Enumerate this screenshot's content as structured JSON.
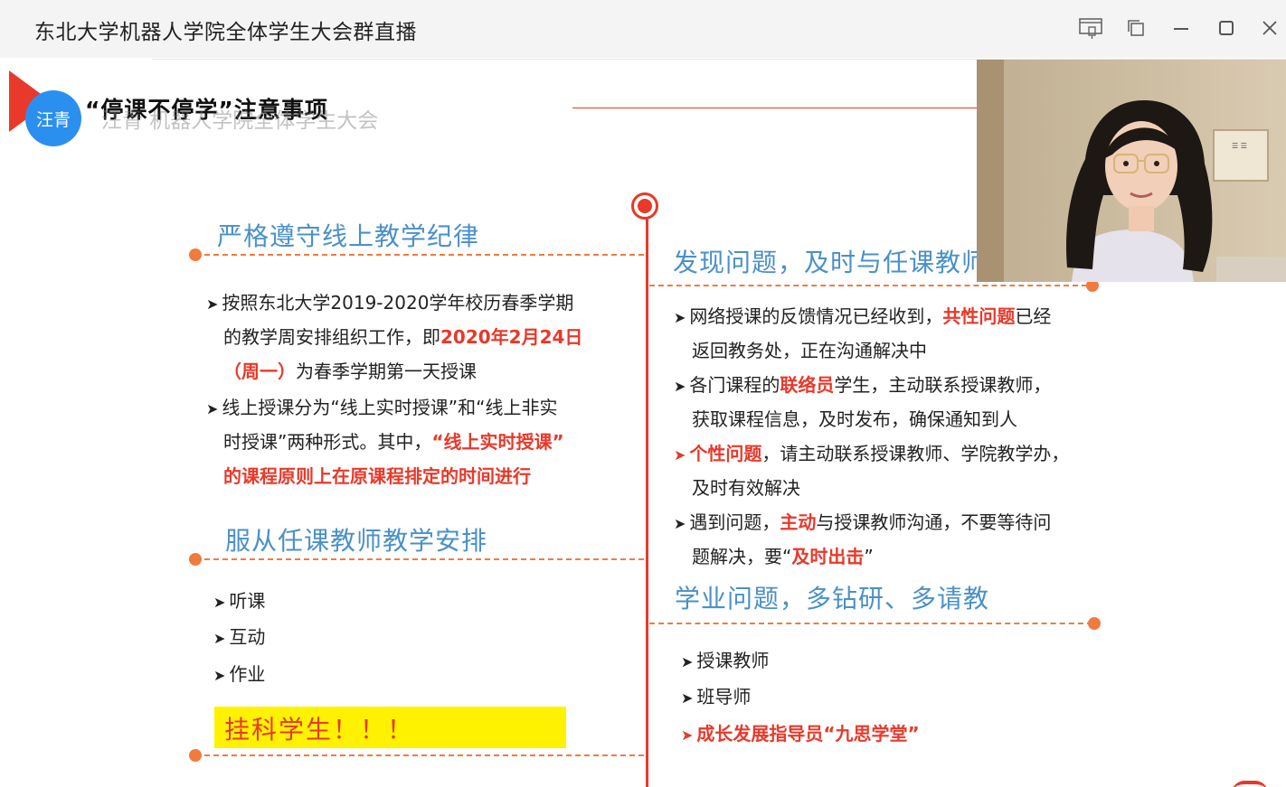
{
  "window": {
    "title": "东北大学机器人学院全体学生大会群直播",
    "controls": [
      "presentation-icon",
      "popout-icon",
      "minimize-icon",
      "maximize-icon",
      "close-icon"
    ]
  },
  "presenter": {
    "avatar_label": "汪青"
  },
  "slide": {
    "title": "“停课不停学”注意事项",
    "overlay_text": "汪青 机器人学院全体学生大会",
    "left": {
      "section1": {
        "title": "严格遵守线上教学纪律",
        "lines": [
          {
            "a": "按照东北大学2019-2020学年校历春季学期",
            "b": "",
            "c": ""
          },
          {
            "a": "的教学周安排组织工作，即",
            "b": "2020年2月24日",
            "c": ""
          },
          {
            "a": "",
            "b": "（周一）",
            "c": "为春季学期第一天授课"
          },
          {
            "a": "线上授课分为“线上实时授课”和“线上非实",
            "b": "",
            "c": ""
          },
          {
            "a": "时授课”两种形式。其中，",
            "b": "“线上实时授课”",
            "c": ""
          },
          {
            "a": "",
            "b": "的课程原则上在原课程排定的时间进行",
            "c": ""
          }
        ]
      },
      "section2": {
        "title": "服从任课教师教学安排",
        "items": [
          "听课",
          "互动",
          "作业"
        ],
        "highlight": "挂科学生！！！"
      }
    },
    "right": {
      "section1": {
        "title": "发现问题，及时与任课教师",
        "lines": [
          {
            "a": "网络授课的反馈情况已经收到，",
            "b": "共性问题",
            "c": "已经"
          },
          {
            "a": "返回教务处，正在沟通解决中",
            "b": "",
            "c": ""
          },
          {
            "a": "各门课程的",
            "b": "联络员",
            "c": "学生，主动联系授课教师，"
          },
          {
            "a": "获取课程信息，及时发布，确保通知到人",
            "b": "",
            "c": ""
          },
          {
            "a": "",
            "b": "个性问题",
            "c": "，请主动联系授课教师、学院教学办，"
          },
          {
            "a": "及时有效解决",
            "b": "",
            "c": ""
          },
          {
            "a": "遇到问题，",
            "b": "主动",
            "c": "与授课教师沟通，不要等待问"
          },
          {
            "a": "题解决，要“",
            "b": "及时出击",
            "c": "”"
          }
        ]
      },
      "section2": {
        "title": "学业问题，多钻研、多请教",
        "items": [
          "授课教师",
          "班导师"
        ],
        "highlight": "成长发展指导员“九思学堂”"
      }
    }
  },
  "colors": {
    "accent": "#e8392a",
    "orange": "#f07b3f",
    "blue": "#4a90c8",
    "yellow": "#fff200"
  }
}
